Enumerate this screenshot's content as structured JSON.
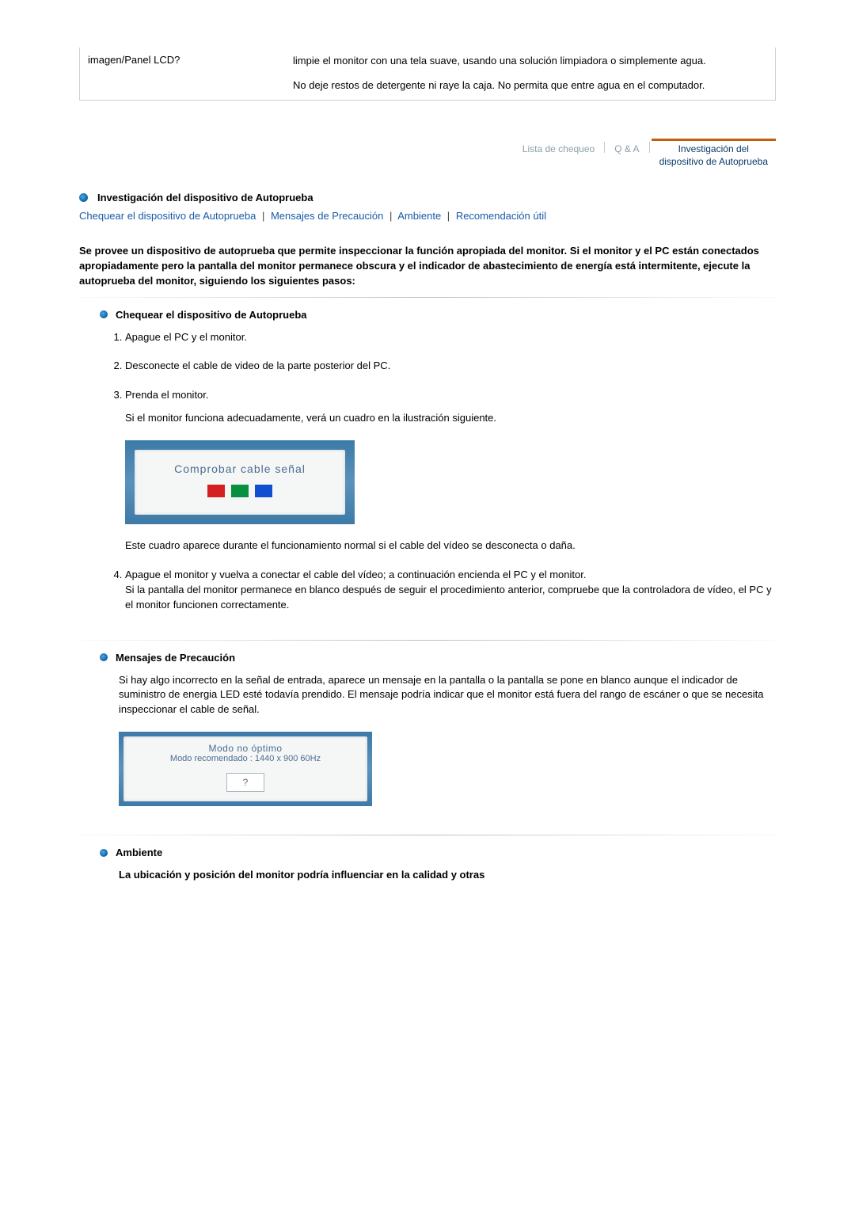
{
  "qa": {
    "question": "imagen/Panel LCD?",
    "answer_p1": "limpie el monitor con una tela suave, usando una solución limpiadora o simplemente agua.",
    "answer_p2": "No deje restos de detergente ni raye la caja. No permita que entre agua en el computador."
  },
  "tabs": {
    "checklist": "Lista de chequeo",
    "qa_label": "Q & A",
    "selftest_l1": "Investigación del",
    "selftest_l2": "dispositivo de Autoprueba"
  },
  "section_title": "Investigación del dispositivo de Autoprueba",
  "links": {
    "selftest": "Chequear el dispositivo de Autoprueba",
    "warnings": "Mensajes de Precaución",
    "env": "Ambiente",
    "recommend": "Recomendación útil"
  },
  "intro": "Se provee un dispositivo de autoprueba que permite inspeccionar la función apropiada del monitor. Si el monitor y el PC están conectados apropiadamente pero la pantalla del monitor permanece obscura y el indicador de abastecimiento de energía está intermitente, ejecute la autoprueba del monitor, siguiendo los siguientes pasos:",
  "selftest": {
    "title": "Chequear el dispositivo de Autoprueba",
    "step1": "Apague el PC y el monitor.",
    "step2": "Desconecte el cable de video de la parte posterior del PC.",
    "step3": "Prenda el monitor.",
    "step3_note": "Si el monitor funciona adecuadamente, verá un cuadro en la ilustración siguiente.",
    "osd1_text": "Comprobar cable señal",
    "step3_after": "Este cuadro aparece durante el funcionamiento normal si el cable del vídeo se desconecta o daña.",
    "step4_a": "Apague el monitor y vuelva a conectar el cable del vídeo; a continuación encienda el PC y el monitor.",
    "step4_b": "Si la pantalla del monitor permanece en blanco después de seguir el procedimiento anterior, compruebe que la controladora de vídeo, el PC y el monitor funcionen correctamente."
  },
  "warnings": {
    "title": "Mensajes de Precaución",
    "body": "Si hay algo incorrecto en la señal de entrada, aparece un mensaje en la pantalla o la pantalla se pone en blanco aunque el indicador de suministro de energia LED esté todavía prendido. El mensaje podría indicar que el monitor está fuera del rango de escáner o que se necesita inspeccionar el cable de señal.",
    "osd2_l1": "Modo no óptimo",
    "osd2_l2": "Modo recomendado : 1440 x 900 60Hz",
    "osd2_btn": "?"
  },
  "env": {
    "title": "Ambiente",
    "body": "La ubicación y posición del monitor podría influenciar en la calidad y otras"
  }
}
